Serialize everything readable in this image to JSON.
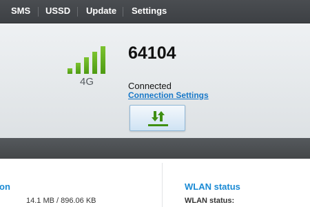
{
  "nav": {
    "items": [
      {
        "label": "SMS"
      },
      {
        "label": "USSD"
      },
      {
        "label": "Update"
      },
      {
        "label": "Settings"
      }
    ]
  },
  "status": {
    "signal_bars": 5,
    "signal_bars_active": 5,
    "network_type": "4G",
    "operator": "64104",
    "connection_state": "Connected",
    "connection_settings_link": "Connection Settings",
    "connect_button_icon": "up-down-arrows-icon"
  },
  "info": {
    "left_title_partial": "on",
    "traffic": "14.1 MB /  896.06 KB",
    "wlan_title": "WLAN status",
    "wlan_label": "WLAN status:"
  },
  "colors": {
    "nav_bg": "#434649",
    "signal_green": "#5fae1e",
    "link_blue": "#1878c8",
    "section_title_blue": "#1a8ad4"
  }
}
